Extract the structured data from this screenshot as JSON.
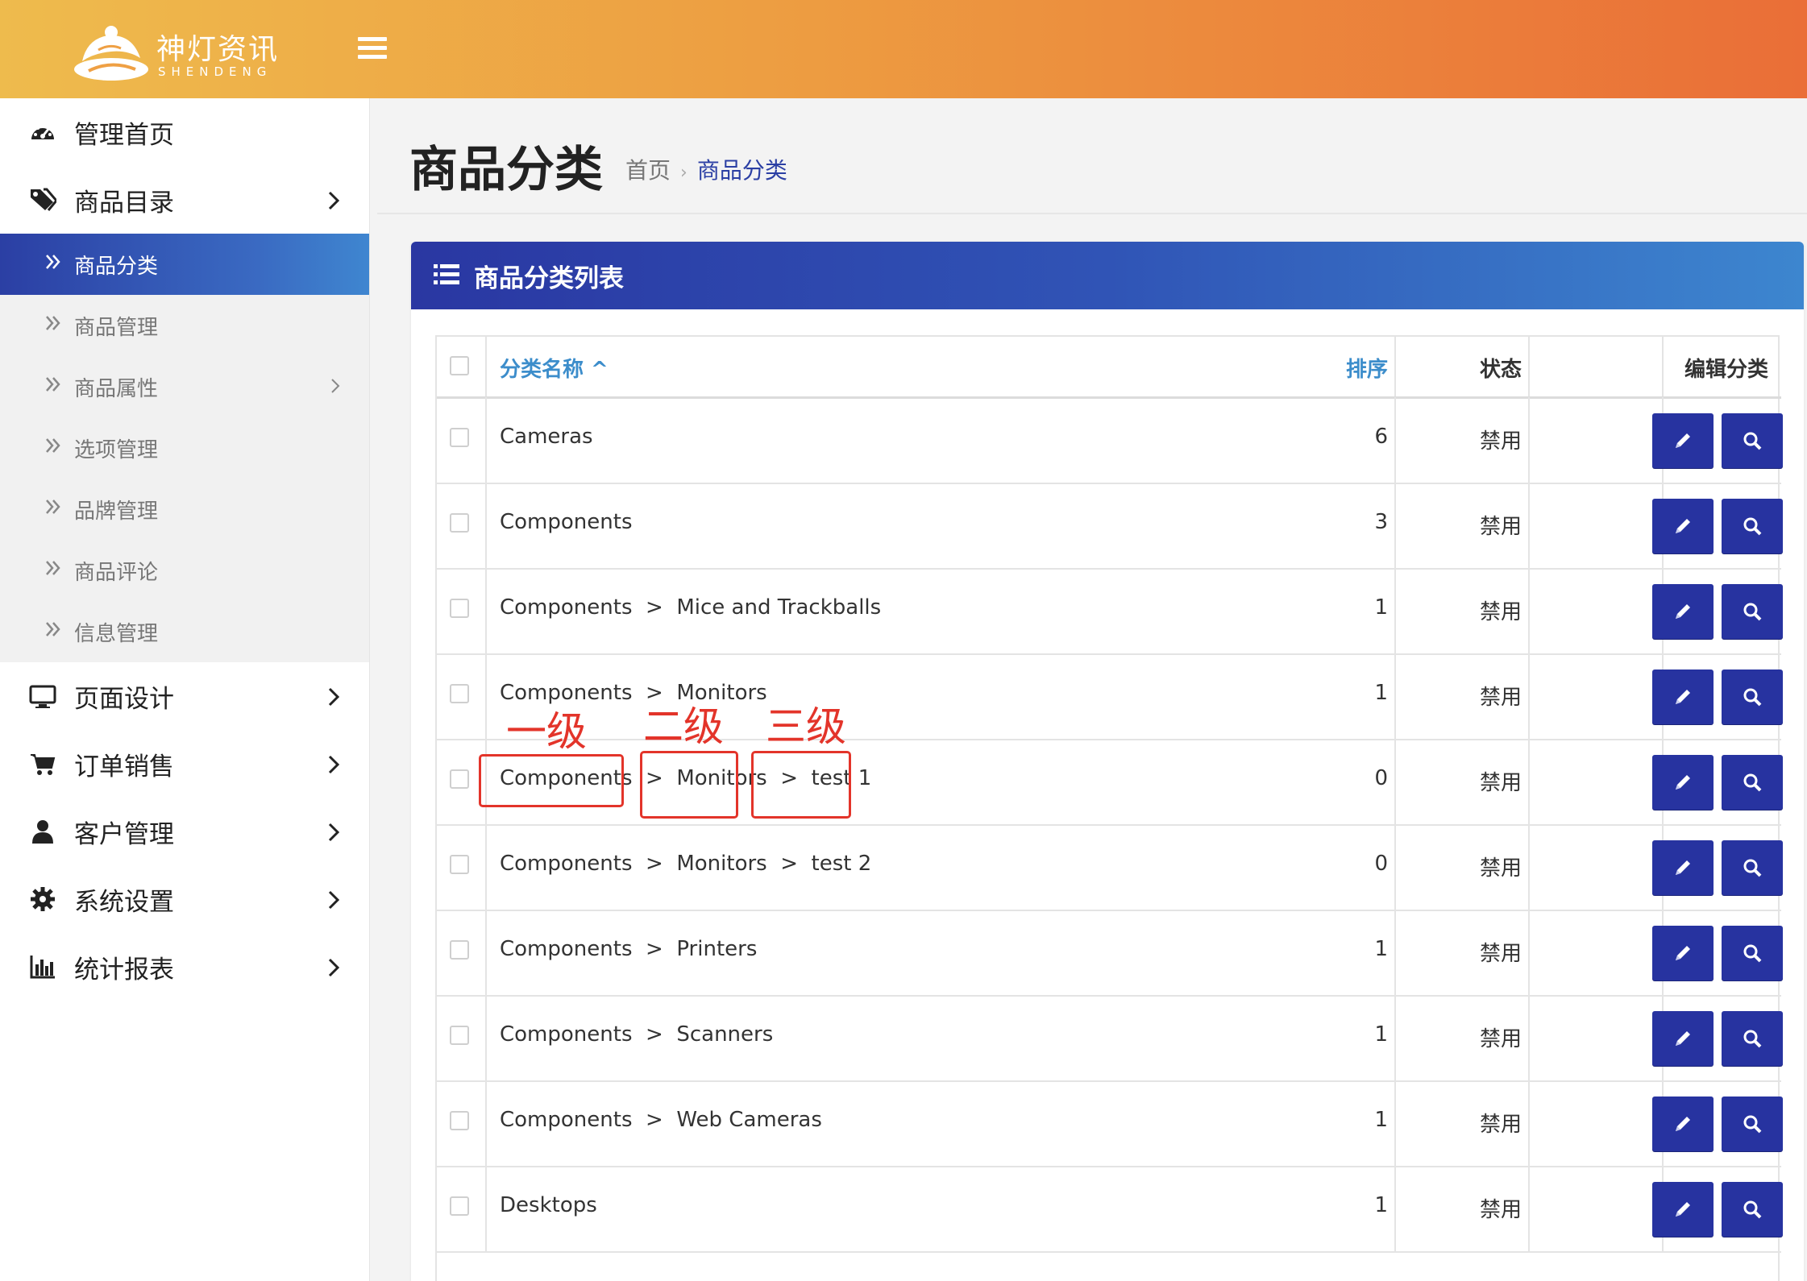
{
  "header": {
    "logo_text": "神灯资讯",
    "logo_sub": "SHENDENG"
  },
  "sidebar": {
    "items": [
      {
        "label": "管理首页",
        "icon": "dashboard-icon"
      },
      {
        "label": "商品目录",
        "icon": "tags-icon"
      },
      {
        "label": "页面设计",
        "icon": "desktop-icon"
      },
      {
        "label": "订单销售",
        "icon": "cart-icon"
      },
      {
        "label": "客户管理",
        "icon": "user-icon"
      },
      {
        "label": "系统设置",
        "icon": "gear-icon"
      },
      {
        "label": "统计报表",
        "icon": "bar-chart-icon"
      }
    ],
    "submenu": [
      {
        "label": "商品分类",
        "active": true
      },
      {
        "label": "商品管理"
      },
      {
        "label": "商品属性",
        "has_children": true
      },
      {
        "label": "选项管理"
      },
      {
        "label": "品牌管理"
      },
      {
        "label": "商品评论"
      },
      {
        "label": "信息管理"
      }
    ]
  },
  "page": {
    "title": "商品分类",
    "breadcrumb": [
      "首页",
      "商品分类"
    ]
  },
  "panel": {
    "title": "商品分类列表"
  },
  "table": {
    "headers": {
      "name": "分类名称 ^",
      "sort": "排序",
      "status": "状态",
      "edit": "编辑分类"
    },
    "rows": [
      {
        "name": "Cameras",
        "sort": "6",
        "status": "禁用"
      },
      {
        "name": "Components",
        "sort": "3",
        "status": "禁用"
      },
      {
        "name": "Components  >  Mice and Trackballs",
        "sort": "1",
        "status": "禁用"
      },
      {
        "name": "Components  >  Monitors",
        "sort": "1",
        "status": "禁用"
      },
      {
        "name": "Components  >  Monitors  >  test 1",
        "sort": "0",
        "status": "禁用"
      },
      {
        "name": "Components  >  Monitors  >  test 2",
        "sort": "0",
        "status": "禁用"
      },
      {
        "name": "Components  >  Printers",
        "sort": "1",
        "status": "禁用"
      },
      {
        "name": "Components  >  Scanners",
        "sort": "1",
        "status": "禁用"
      },
      {
        "name": "Components  >  Web Cameras",
        "sort": "1",
        "status": "禁用"
      },
      {
        "name": "Desktops",
        "sort": "1",
        "status": "禁用"
      }
    ]
  },
  "annotations": {
    "level1": "一级",
    "level2": "二级",
    "level3": "三级",
    "color": "#e3342a"
  },
  "colors": {
    "header_start": "#eebb4d",
    "header_end": "#ea6e37",
    "primary": "#2733a0",
    "link": "#3c8dcb"
  }
}
